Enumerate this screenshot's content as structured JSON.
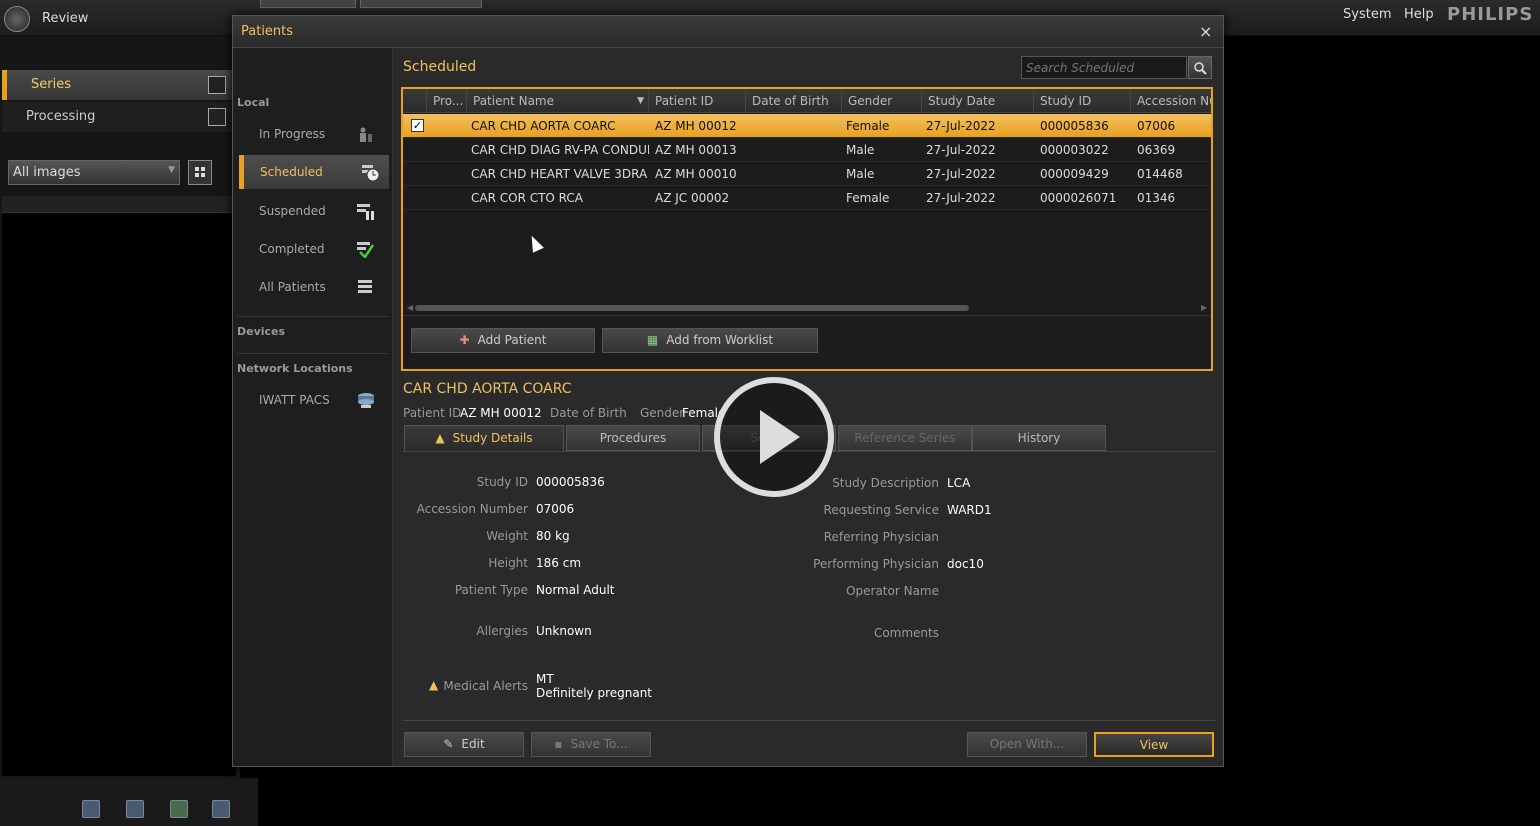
{
  "app": {
    "title": "Review",
    "system": "System",
    "help": "Help",
    "brand": "PHILIPS"
  },
  "left": {
    "series": "Series",
    "processing": "Processing",
    "filter": "All images"
  },
  "dialog": {
    "title": "Patients",
    "close": "×",
    "nav": {
      "local_header": "Local",
      "items": [
        {
          "label": "In Progress",
          "icon": "in-progress-icon"
        },
        {
          "label": "Scheduled",
          "icon": "scheduled-clock-icon"
        },
        {
          "label": "Suspended",
          "icon": "suspended-icon"
        },
        {
          "label": "Completed",
          "icon": "completed-check-icon"
        },
        {
          "label": "All Patients",
          "icon": "list-icon"
        }
      ],
      "devices_header": "Devices",
      "network_header": "Network Locations",
      "network_items": [
        {
          "label": "IWATT PACS",
          "icon": "pacs-server-icon"
        }
      ]
    },
    "main": {
      "section_title": "Scheduled",
      "search_placeholder": "Search Scheduled",
      "columns": [
        "Pro...",
        "Patient Name",
        "Patient ID",
        "Date of Birth",
        "Gender",
        "Study Date",
        "Study ID",
        "Accession Nu"
      ],
      "rows": [
        {
          "checked": "✓",
          "name": "CAR CHD AORTA COARC",
          "pid": "AZ MH 00012",
          "dob": "",
          "gender": "Female",
          "date": "27-Jul-2022",
          "sid": "000005836",
          "acc": "07006",
          "selected": true
        },
        {
          "checked": "",
          "name": "CAR CHD DIAG RV-PA CONDUIT",
          "pid": "AZ MH 00013",
          "dob": "",
          "gender": "Male",
          "date": "27-Jul-2022",
          "sid": "000003022",
          "acc": "06369",
          "selected": false
        },
        {
          "checked": "",
          "name": "CAR CHD HEART VALVE 3DRA ...",
          "pid": "AZ MH 00010",
          "dob": "",
          "gender": "Male",
          "date": "27-Jul-2022",
          "sid": "000009429",
          "acc": "014468",
          "selected": false
        },
        {
          "checked": "",
          "name": "CAR COR CTO RCA",
          "pid": "AZ JC 00002",
          "dob": "",
          "gender": "Female",
          "date": "27-Jul-2022",
          "sid": "0000026071",
          "acc": "01346",
          "selected": false
        }
      ],
      "add_patient": "Add Patient",
      "add_worklist": "Add from Worklist"
    },
    "detail": {
      "patient_name": "CAR CHD AORTA COARC",
      "patient_id_label": "Patient ID",
      "patient_id": "AZ MH 00012",
      "dob_label": "Date of Birth",
      "gender_label": "Gender",
      "gender": "Female",
      "tabs": [
        "Study Details",
        "Procedures",
        "Series",
        "Reference Series",
        "History"
      ],
      "left_fields": [
        {
          "label": "Study ID",
          "value": "000005836"
        },
        {
          "label": "Accession Number",
          "value": "07006"
        },
        {
          "label": "Weight",
          "value": "80 kg"
        },
        {
          "label": "Height",
          "value": "186 cm"
        },
        {
          "label": "Patient Type",
          "value": "Normal Adult"
        },
        {
          "label": "Allergies",
          "value": "Unknown"
        },
        {
          "label": "Medical Alerts",
          "value": "MT",
          "value2": "Definitely pregnant"
        }
      ],
      "right_fields": [
        {
          "label": "Study Description",
          "value": "LCA"
        },
        {
          "label": "Requesting Service",
          "value": "WARD1"
        },
        {
          "label": "Referring Physician",
          "value": ""
        },
        {
          "label": "Performing Physician",
          "value": "doc10"
        },
        {
          "label": "Operator Name",
          "value": ""
        },
        {
          "label": "Comments",
          "value": ""
        }
      ],
      "edit": "Edit",
      "save_to": "Save To...",
      "open_with": "Open With...",
      "view": "View"
    }
  },
  "colors": {
    "accent": "#e8a020",
    "title": "#f0c060"
  }
}
